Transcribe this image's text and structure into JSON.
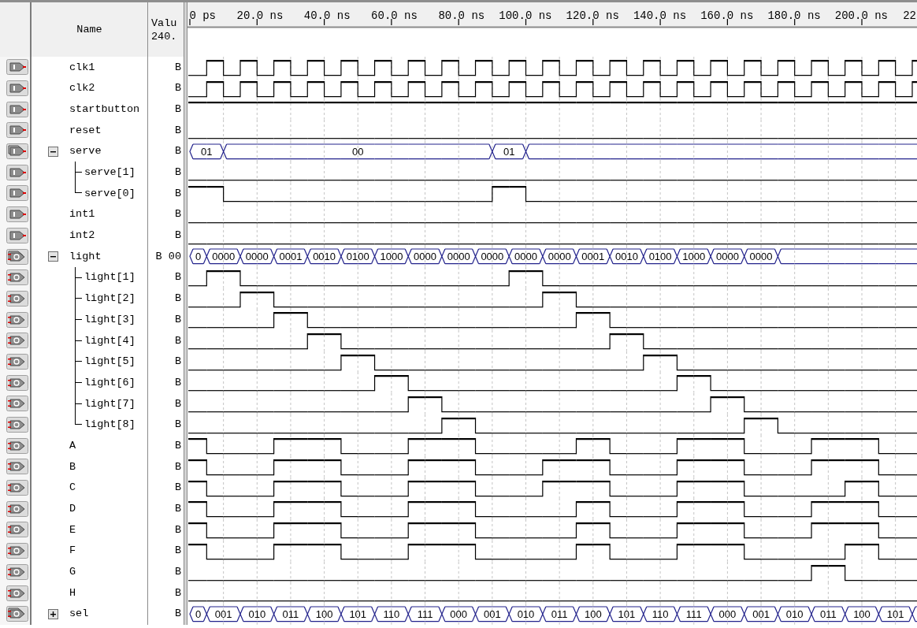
{
  "header": {
    "name": "Name",
    "value": [
      "Valu",
      "240."
    ]
  },
  "ruler": [
    "0 ps",
    "20.0 ns",
    "40.0 ns",
    "60.0 ns",
    "80.0 ns",
    "100.0 ns",
    "120.0 ns",
    "140.0 ns",
    "160.0 ns",
    "180.0 ns",
    "200.0 ns",
    "22"
  ],
  "signals": [
    {
      "name": "clk1",
      "kind": "input",
      "value": "B",
      "high": [
        false,
        true,
        false,
        true,
        false,
        true,
        false,
        true,
        false,
        true,
        false,
        true,
        false,
        true,
        false,
        true,
        false,
        true,
        false,
        true,
        false,
        true,
        false,
        true,
        false,
        true,
        false,
        true,
        false,
        true,
        false,
        true,
        false,
        true,
        false,
        true,
        false,
        true,
        false,
        true,
        false,
        true,
        false,
        true
      ]
    },
    {
      "name": "clk2",
      "kind": "input",
      "value": "B",
      "high": [
        false,
        true,
        false,
        true,
        false,
        true,
        false,
        true,
        false,
        true,
        false,
        true,
        false,
        true,
        false,
        true,
        false,
        true,
        false,
        true,
        false,
        true,
        false,
        true,
        false,
        true,
        false,
        true,
        false,
        true,
        false,
        true,
        false,
        true,
        false,
        true,
        false,
        true,
        false,
        true,
        false,
        true,
        false,
        true
      ]
    },
    {
      "name": "startbutton",
      "kind": "input",
      "value": "B",
      "high": [
        true,
        true,
        true,
        true,
        true,
        true,
        true,
        true,
        true,
        true,
        true,
        true,
        true,
        true,
        true,
        true,
        true,
        true,
        true,
        true,
        true,
        true,
        true,
        true,
        true,
        true,
        true,
        true,
        true,
        true,
        true,
        true,
        true,
        true,
        true,
        true,
        true,
        true,
        true,
        true,
        true,
        true,
        true,
        true
      ]
    },
    {
      "name": "reset",
      "kind": "input",
      "value": "B",
      "high": [
        false,
        false,
        false,
        false,
        false,
        false,
        false,
        false,
        false,
        false,
        false,
        false,
        false,
        false,
        false,
        false,
        false,
        false,
        false,
        false,
        false,
        false,
        false,
        false,
        false,
        false,
        false,
        false,
        false,
        false,
        false,
        false,
        false,
        false,
        false,
        false,
        false,
        false,
        false,
        false,
        false,
        false,
        false,
        false
      ]
    },
    {
      "name": "serve",
      "kind": "input",
      "value": "B",
      "expanded": true,
      "starts": [
        true,
        false,
        true,
        false,
        false,
        false,
        false,
        false,
        false,
        false,
        false,
        false,
        false,
        false,
        false,
        false,
        false,
        false,
        true,
        false,
        true,
        false,
        false,
        false,
        false,
        false,
        false,
        false,
        false,
        false,
        false,
        false,
        false,
        false,
        false,
        false,
        false,
        false,
        false,
        false,
        false,
        false,
        false,
        false
      ],
      "labels": [
        "01",
        "00",
        "01"
      ],
      "children": [
        {
          "name": "serve[1]",
          "kind": "input",
          "value": "B",
          "high": [
            false,
            false,
            false,
            false,
            false,
            false,
            false,
            false,
            false,
            false,
            false,
            false,
            false,
            false,
            false,
            false,
            false,
            false,
            false,
            false,
            false,
            false,
            false,
            false,
            false,
            false,
            false,
            false,
            false,
            false,
            false,
            false,
            false,
            false,
            false,
            false,
            false,
            false,
            false,
            false,
            false,
            false,
            false,
            false
          ]
        },
        {
          "name": "serve[0]",
          "kind": "input",
          "value": "B",
          "high": [
            true,
            true,
            false,
            false,
            false,
            false,
            false,
            false,
            false,
            false,
            false,
            false,
            false,
            false,
            false,
            false,
            false,
            false,
            true,
            true,
            false,
            false,
            false,
            false,
            false,
            false,
            false,
            false,
            false,
            false,
            false,
            false,
            false,
            false,
            false,
            false,
            false,
            false,
            false,
            false,
            false,
            false,
            false,
            false
          ]
        }
      ]
    },
    {
      "name": "int1",
      "kind": "input",
      "value": "B",
      "high": [
        false,
        false,
        false,
        false,
        false,
        false,
        false,
        false,
        false,
        false,
        false,
        false,
        false,
        false,
        false,
        false,
        false,
        false,
        false,
        false,
        false,
        false,
        false,
        false,
        false,
        false,
        false,
        false,
        false,
        false,
        false,
        false,
        false,
        false,
        false,
        false,
        false,
        false,
        false,
        false,
        false,
        false,
        false,
        false
      ]
    },
    {
      "name": "int2",
      "kind": "input",
      "value": "B",
      "high": [
        false,
        false,
        false,
        false,
        false,
        false,
        false,
        false,
        false,
        false,
        false,
        false,
        false,
        false,
        false,
        false,
        false,
        false,
        false,
        false,
        false,
        false,
        false,
        false,
        false,
        false,
        false,
        false,
        false,
        false,
        false,
        false,
        false,
        false,
        false,
        false,
        false,
        false,
        false,
        false,
        false,
        false,
        false,
        false
      ]
    },
    {
      "name": "light",
      "kind": "output",
      "value": "B 00",
      "expanded": true,
      "starts": [
        true,
        true,
        false,
        true,
        false,
        true,
        false,
        true,
        false,
        true,
        false,
        true,
        false,
        true,
        false,
        true,
        false,
        true,
        false,
        true,
        false,
        true,
        false,
        true,
        false,
        true,
        false,
        true,
        false,
        true,
        false,
        true,
        false,
        true,
        false,
        true,
        false,
        false,
        false,
        false,
        false,
        false,
        false,
        false
      ],
      "labels": [
        "0",
        "0000",
        "0000",
        "0001",
        "0010",
        "0100",
        "1000",
        "0000",
        "0000",
        "0000",
        "0000",
        "0000",
        "0001",
        "0010",
        "0100",
        "1000",
        "0000",
        "0000"
      ],
      "children": [
        {
          "name": "light[1]",
          "kind": "output",
          "value": "B",
          "high": [
            false,
            true,
            true,
            false,
            false,
            false,
            false,
            false,
            false,
            false,
            false,
            false,
            false,
            false,
            false,
            false,
            false,
            false,
            false,
            true,
            true,
            false,
            false,
            false,
            false,
            false,
            false,
            false,
            false,
            false,
            false,
            false,
            false,
            false,
            false,
            false,
            false,
            false,
            false,
            false,
            false,
            false,
            false,
            false
          ]
        },
        {
          "name": "light[2]",
          "kind": "output",
          "value": "B",
          "high": [
            false,
            false,
            false,
            true,
            true,
            false,
            false,
            false,
            false,
            false,
            false,
            false,
            false,
            false,
            false,
            false,
            false,
            false,
            false,
            false,
            false,
            true,
            true,
            false,
            false,
            false,
            false,
            false,
            false,
            false,
            false,
            false,
            false,
            false,
            false,
            false,
            false,
            false,
            false,
            false,
            false,
            false,
            false,
            false
          ]
        },
        {
          "name": "light[3]",
          "kind": "output",
          "value": "B",
          "high": [
            false,
            false,
            false,
            false,
            false,
            true,
            true,
            false,
            false,
            false,
            false,
            false,
            false,
            false,
            false,
            false,
            false,
            false,
            false,
            false,
            false,
            false,
            false,
            true,
            true,
            false,
            false,
            false,
            false,
            false,
            false,
            false,
            false,
            false,
            false,
            false,
            false,
            false,
            false,
            false,
            false,
            false,
            false,
            false
          ]
        },
        {
          "name": "light[4]",
          "kind": "output",
          "value": "B",
          "high": [
            false,
            false,
            false,
            false,
            false,
            false,
            false,
            true,
            true,
            false,
            false,
            false,
            false,
            false,
            false,
            false,
            false,
            false,
            false,
            false,
            false,
            false,
            false,
            false,
            false,
            true,
            true,
            false,
            false,
            false,
            false,
            false,
            false,
            false,
            false,
            false,
            false,
            false,
            false,
            false,
            false,
            false,
            false,
            false
          ]
        },
        {
          "name": "light[5]",
          "kind": "output",
          "value": "B",
          "high": [
            false,
            false,
            false,
            false,
            false,
            false,
            false,
            false,
            false,
            true,
            true,
            false,
            false,
            false,
            false,
            false,
            false,
            false,
            false,
            false,
            false,
            false,
            false,
            false,
            false,
            false,
            false,
            true,
            true,
            false,
            false,
            false,
            false,
            false,
            false,
            false,
            false,
            false,
            false,
            false,
            false,
            false,
            false,
            false
          ]
        },
        {
          "name": "light[6]",
          "kind": "output",
          "value": "B",
          "high": [
            false,
            false,
            false,
            false,
            false,
            false,
            false,
            false,
            false,
            false,
            false,
            true,
            true,
            false,
            false,
            false,
            false,
            false,
            false,
            false,
            false,
            false,
            false,
            false,
            false,
            false,
            false,
            false,
            false,
            true,
            true,
            false,
            false,
            false,
            false,
            false,
            false,
            false,
            false,
            false,
            false,
            false,
            false,
            false
          ]
        },
        {
          "name": "light[7]",
          "kind": "output",
          "value": "B",
          "high": [
            false,
            false,
            false,
            false,
            false,
            false,
            false,
            false,
            false,
            false,
            false,
            false,
            false,
            true,
            true,
            false,
            false,
            false,
            false,
            false,
            false,
            false,
            false,
            false,
            false,
            false,
            false,
            false,
            false,
            false,
            false,
            true,
            true,
            false,
            false,
            false,
            false,
            false,
            false,
            false,
            false,
            false,
            false,
            false
          ]
        },
        {
          "name": "light[8]",
          "kind": "output",
          "value": "B",
          "high": [
            false,
            false,
            false,
            false,
            false,
            false,
            false,
            false,
            false,
            false,
            false,
            false,
            false,
            false,
            false,
            true,
            true,
            false,
            false,
            false,
            false,
            false,
            false,
            false,
            false,
            false,
            false,
            false,
            false,
            false,
            false,
            false,
            false,
            true,
            true,
            false,
            false,
            false,
            false,
            false,
            false,
            false,
            false,
            false
          ]
        }
      ]
    },
    {
      "name": "A",
      "kind": "output",
      "value": "B",
      "high": [
        true,
        false,
        false,
        false,
        false,
        true,
        true,
        true,
        true,
        false,
        false,
        false,
        false,
        true,
        true,
        true,
        true,
        false,
        false,
        false,
        false,
        false,
        false,
        true,
        true,
        false,
        false,
        false,
        false,
        true,
        true,
        true,
        true,
        false,
        false,
        false,
        false,
        true,
        true,
        true,
        true,
        false,
        false,
        false
      ]
    },
    {
      "name": "B",
      "kind": "output",
      "value": "B",
      "high": [
        true,
        false,
        false,
        false,
        false,
        true,
        true,
        true,
        true,
        false,
        false,
        false,
        false,
        true,
        true,
        true,
        true,
        false,
        false,
        false,
        false,
        true,
        true,
        true,
        true,
        false,
        false,
        false,
        false,
        true,
        true,
        true,
        true,
        false,
        false,
        false,
        false,
        true,
        true,
        true,
        true,
        false,
        false,
        false
      ]
    },
    {
      "name": "C",
      "kind": "output",
      "value": "B",
      "high": [
        true,
        false,
        false,
        false,
        false,
        true,
        true,
        true,
        true,
        false,
        false,
        false,
        false,
        true,
        true,
        true,
        true,
        false,
        false,
        false,
        false,
        true,
        true,
        true,
        true,
        false,
        false,
        false,
        false,
        true,
        true,
        true,
        true,
        false,
        false,
        false,
        false,
        false,
        false,
        true,
        true,
        false,
        false,
        false
      ]
    },
    {
      "name": "D",
      "kind": "output",
      "value": "B",
      "high": [
        true,
        false,
        false,
        false,
        false,
        true,
        true,
        true,
        true,
        false,
        false,
        false,
        false,
        true,
        true,
        true,
        true,
        false,
        false,
        false,
        false,
        false,
        false,
        true,
        true,
        false,
        false,
        false,
        false,
        true,
        true,
        true,
        true,
        false,
        false,
        false,
        false,
        true,
        true,
        true,
        true,
        false,
        false,
        false
      ]
    },
    {
      "name": "E",
      "kind": "output",
      "value": "B",
      "high": [
        true,
        false,
        false,
        false,
        false,
        true,
        true,
        true,
        true,
        false,
        false,
        false,
        false,
        true,
        true,
        true,
        true,
        false,
        false,
        false,
        false,
        false,
        false,
        true,
        true,
        false,
        false,
        false,
        false,
        true,
        true,
        true,
        true,
        false,
        false,
        false,
        false,
        true,
        true,
        true,
        true,
        false,
        false,
        false
      ]
    },
    {
      "name": "F",
      "kind": "output",
      "value": "B",
      "high": [
        true,
        false,
        false,
        false,
        false,
        true,
        true,
        true,
        true,
        false,
        false,
        false,
        false,
        true,
        true,
        true,
        true,
        false,
        false,
        false,
        false,
        false,
        false,
        true,
        true,
        false,
        false,
        false,
        false,
        true,
        true,
        true,
        true,
        false,
        false,
        false,
        false,
        false,
        false,
        true,
        true,
        false,
        false,
        false
      ]
    },
    {
      "name": "G",
      "kind": "output",
      "value": "B",
      "high": [
        false,
        false,
        false,
        false,
        false,
        false,
        false,
        false,
        false,
        false,
        false,
        false,
        false,
        false,
        false,
        false,
        false,
        false,
        false,
        false,
        false,
        false,
        false,
        false,
        false,
        false,
        false,
        false,
        false,
        false,
        false,
        false,
        false,
        false,
        false,
        false,
        false,
        true,
        true,
        false,
        false,
        false,
        false,
        false
      ]
    },
    {
      "name": "H",
      "kind": "output",
      "value": "B",
      "high": [
        false,
        false,
        false,
        false,
        false,
        false,
        false,
        false,
        false,
        false,
        false,
        false,
        false,
        false,
        false,
        false,
        false,
        false,
        false,
        false,
        false,
        false,
        false,
        false,
        false,
        false,
        false,
        false,
        false,
        false,
        false,
        false,
        false,
        false,
        false,
        false,
        false,
        false,
        false,
        false,
        false,
        false,
        false,
        false
      ]
    },
    {
      "name": "sel",
      "kind": "output",
      "value": "B",
      "expanded": false,
      "starts": [
        true,
        true,
        false,
        true,
        false,
        true,
        false,
        true,
        false,
        true,
        false,
        true,
        false,
        true,
        false,
        true,
        false,
        true,
        false,
        true,
        false,
        true,
        false,
        true,
        false,
        true,
        false,
        true,
        false,
        true,
        false,
        true,
        false,
        true,
        false,
        true,
        false,
        true,
        false,
        true,
        false,
        true,
        false,
        true
      ],
      "labels": [
        "0",
        "001",
        "010",
        "011",
        "100",
        "101",
        "110",
        "111",
        "000",
        "001",
        "010",
        "011",
        "100",
        "101",
        "110",
        "111",
        "000",
        "001",
        "010",
        "011",
        "100",
        "101"
      ]
    }
  ]
}
